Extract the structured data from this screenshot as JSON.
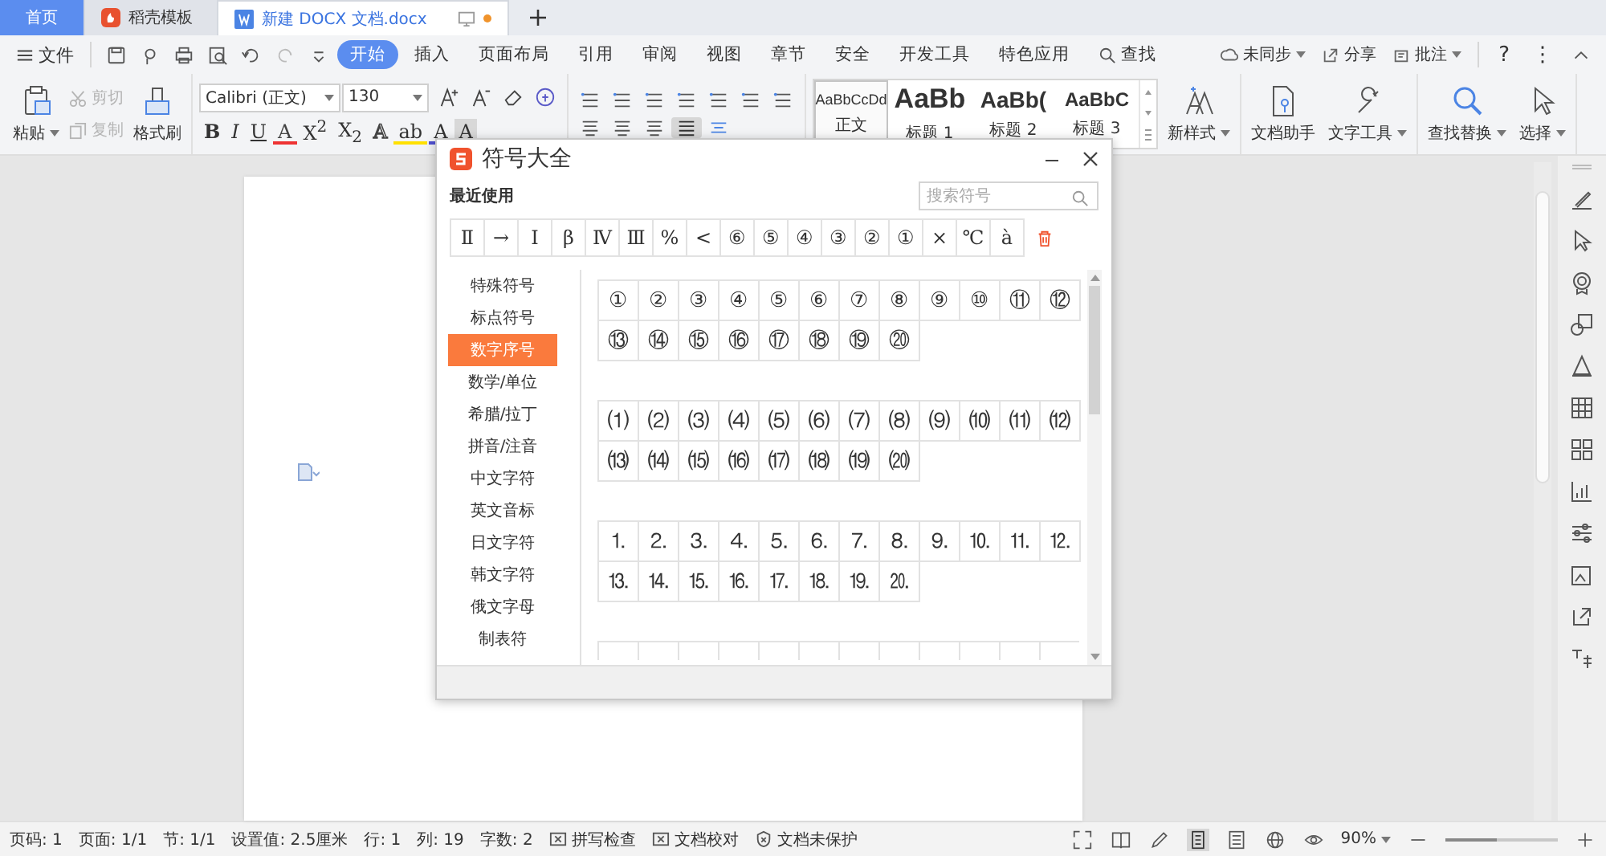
{
  "tabs": [
    {
      "label": "首页",
      "kind": "home",
      "selected": false
    },
    {
      "label": "稻壳模板",
      "kind": "template",
      "selected": false
    },
    {
      "label": "新建 DOCX 文档.docx",
      "kind": "document",
      "selected": true
    }
  ],
  "menu": {
    "file": "文件",
    "items": [
      {
        "label": "开始",
        "selected": true
      },
      {
        "label": "插入",
        "selected": false
      },
      {
        "label": "页面布局",
        "selected": false
      },
      {
        "label": "引用",
        "selected": false
      },
      {
        "label": "审阅",
        "selected": false
      },
      {
        "label": "视图",
        "selected": false
      },
      {
        "label": "章节",
        "selected": false
      },
      {
        "label": "安全",
        "selected": false
      },
      {
        "label": "开发工具",
        "selected": false
      },
      {
        "label": "特色应用",
        "selected": false
      }
    ],
    "search": "查找",
    "sync": "未同步",
    "share": "分享",
    "comment": "批注",
    "help": "?",
    "more": "⋮"
  },
  "ribbon": {
    "paste": "粘贴",
    "cut": {
      "label": "剪切",
      "disabled": true
    },
    "copy": {
      "label": "复制",
      "disabled": true
    },
    "format_painter": "格式刷",
    "font": "Calibri (正文)",
    "size": "130",
    "font_buttons": [
      {
        "label": "B",
        "kind": "bold"
      },
      {
        "label": "I",
        "kind": "italic"
      },
      {
        "label": "U",
        "kind": "underline"
      },
      {
        "label": "A",
        "kind": "strike"
      },
      {
        "label": "X$^{2}$",
        "kind": "plain"
      },
      {
        "label": "X$_{2}$",
        "kind": "plain"
      },
      {
        "label": "A",
        "kind": "outline"
      },
      {
        "label": "ab",
        "kind": "highlight"
      },
      {
        "label": "A",
        "kind": "color"
      },
      {
        "label": "A",
        "kind": "shade"
      }
    ],
    "styles": [
      {
        "preview": "AaBbCcDd",
        "label": "正文",
        "kind": "body",
        "selected": true
      },
      {
        "preview": "AaBb",
        "label": "标题 1",
        "kind": "h1",
        "selected": false
      },
      {
        "preview": "AaBb(",
        "label": "标题 2",
        "kind": "h2",
        "selected": false
      },
      {
        "preview": "AaBbC",
        "label": "标题 3",
        "kind": "h3",
        "selected": false
      }
    ],
    "new_style": "新样式",
    "assistant": "文档助手",
    "text_tools": "文字工具",
    "find_replace": "查找替换",
    "select": "选择"
  },
  "dialog": {
    "title": "符号大全",
    "recent_label": "最近使用",
    "search": {
      "placeholder": "搜索符号"
    },
    "recent": [
      "Ⅱ",
      "→",
      "Ⅰ",
      "β",
      "Ⅳ",
      "Ⅲ",
      "%",
      "<",
      "⑥",
      "⑤",
      "④",
      "③",
      "②",
      "①",
      "×",
      "℃",
      "à"
    ],
    "categories": [
      {
        "label": "特殊符号",
        "selected": false
      },
      {
        "label": "标点符号",
        "selected": false
      },
      {
        "label": "数字序号",
        "selected": true
      },
      {
        "label": "数学/单位",
        "selected": false
      },
      {
        "label": "希腊/拉丁",
        "selected": false
      },
      {
        "label": "拼音/注音",
        "selected": false
      },
      {
        "label": "中文字符",
        "selected": false
      },
      {
        "label": "英文音标",
        "selected": false
      },
      {
        "label": "日文字符",
        "selected": false
      },
      {
        "label": "韩文字符",
        "selected": false
      },
      {
        "label": "俄文字母",
        "selected": false
      },
      {
        "label": "制表符",
        "selected": false
      }
    ],
    "groups": [
      {
        "symbols": [
          "①",
          "②",
          "③",
          "④",
          "⑤",
          "⑥",
          "⑦",
          "⑧",
          "⑨",
          "⑩",
          "⑪",
          "⑫",
          "⑬",
          "⑭",
          "⑮",
          "⑯",
          "⑰",
          "⑱",
          "⑲",
          "⑳"
        ]
      },
      {
        "symbols": [
          "⑴",
          "⑵",
          "⑶",
          "⑷",
          "⑸",
          "⑹",
          "⑺",
          "⑻",
          "⑼",
          "⑽",
          "⑾",
          "⑿",
          "⒀",
          "⒁",
          "⒂",
          "⒃",
          "⒄",
          "⒅",
          "⒆",
          "⒇"
        ]
      },
      {
        "symbols": [
          "⒈",
          "⒉",
          "⒊",
          "⒋",
          "⒌",
          "⒍",
          "⒎",
          "⒏",
          "⒐",
          "⒑",
          "⒒",
          "⒓",
          "⒔",
          "⒕",
          "⒖",
          "⒗",
          "⒘",
          "⒙",
          "⒚",
          "⒛"
        ]
      }
    ]
  },
  "status_bar": {
    "items": [
      "页码: 1",
      "页面: 1/1",
      "节: 1/1",
      "设置值: 2.5厘米",
      "行: 1",
      "列: 19",
      "字数: 2"
    ],
    "spell": "拼写检查",
    "proof": "文档校对",
    "protect": "文档未保护",
    "zoom": "90%",
    "zoom_slider": {
      "level": 0.45
    }
  }
}
